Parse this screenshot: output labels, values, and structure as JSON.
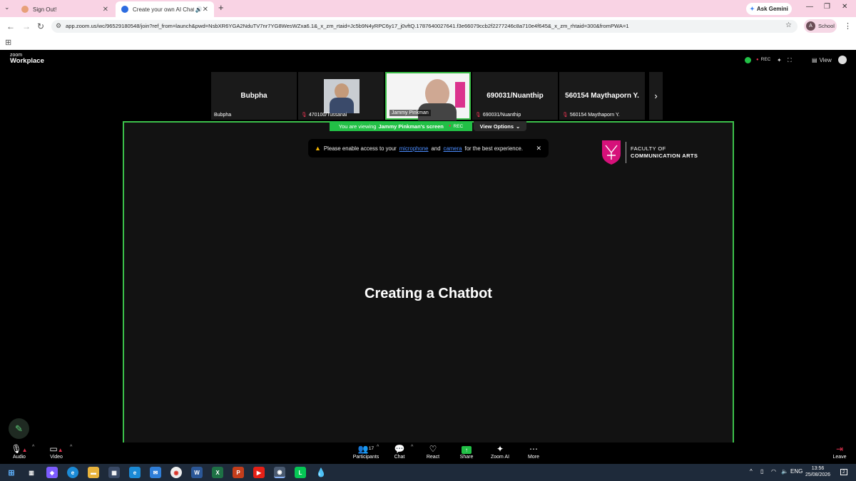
{
  "browser": {
    "tabs": [
      {
        "title": "Sign Out!",
        "active": false
      },
      {
        "title": "Create your own AI Chatbot",
        "active": true
      }
    ],
    "ask_gemini": "Ask Gemini",
    "url": "app.zoom.us/wc/96529180548/join?ref_from=launch&pwd=NsbXR6YGA2NduTV7nr7YG8WesWZxa6.1&_x_zm_rtaid=Jc5b9N4yRPC6y17_j0vftQ.1787640027641.f3e66079ccb2f2277246c8a710e4f645&_x_zm_rhtaid=300&fromPWA=1",
    "profile_initial": "A",
    "profile_label": "School"
  },
  "zoom": {
    "logo_top": "zoom",
    "logo_bottom": "Workplace",
    "rec_label": "REC",
    "view_label": "View",
    "participants_strip": [
      {
        "big_name": "Bubpha",
        "label": "Bubpha",
        "muted": false,
        "video": false
      },
      {
        "big_name": "",
        "label": "470100/Tussanai",
        "muted": true,
        "video": true
      },
      {
        "big_name": "",
        "label": "Jammy Pinkman",
        "muted": false,
        "video": true,
        "active_speaker": true
      },
      {
        "big_name": "690031/Nuanthip",
        "label": "690031/Nuanthip",
        "muted": true,
        "video": false
      },
      {
        "big_name": "560154 Maythaporn Y.",
        "label": "560154 Maythaporn Y.",
        "muted": true,
        "video": false
      }
    ],
    "viewing_banner": {
      "prefix": "You are viewing",
      "name": "Jammy Pinkman's screen",
      "rec": "REC"
    },
    "view_options": "View Options",
    "notice": {
      "before": "Please enable access to your",
      "link1": "microphone",
      "middle": "and",
      "link2": "camera",
      "after": "for the best experience."
    },
    "slide": {
      "title": "Creating a Chatbot",
      "logo_line1": "FACULTY OF",
      "logo_line2": "COMMUNICATION ARTS"
    },
    "toolbar": {
      "audio": "Audio",
      "video": "Video",
      "participants": "Participants",
      "participants_count": "17",
      "chat": "Chat",
      "react": "React",
      "share": "Share",
      "zoom_ai": "Zoom AI",
      "more": "More",
      "leave": "Leave"
    }
  },
  "taskbar": {
    "language": "ENG",
    "time": "13:56",
    "date": "25/08/2026",
    "notification_count": "2"
  },
  "colors": {
    "share_border": "#3cc14a",
    "viewing_banner": "#22c046",
    "brand_magenta": "#d6117a",
    "tab_strip": "#f9d3e4",
    "taskbar": "#1e2a3a"
  }
}
